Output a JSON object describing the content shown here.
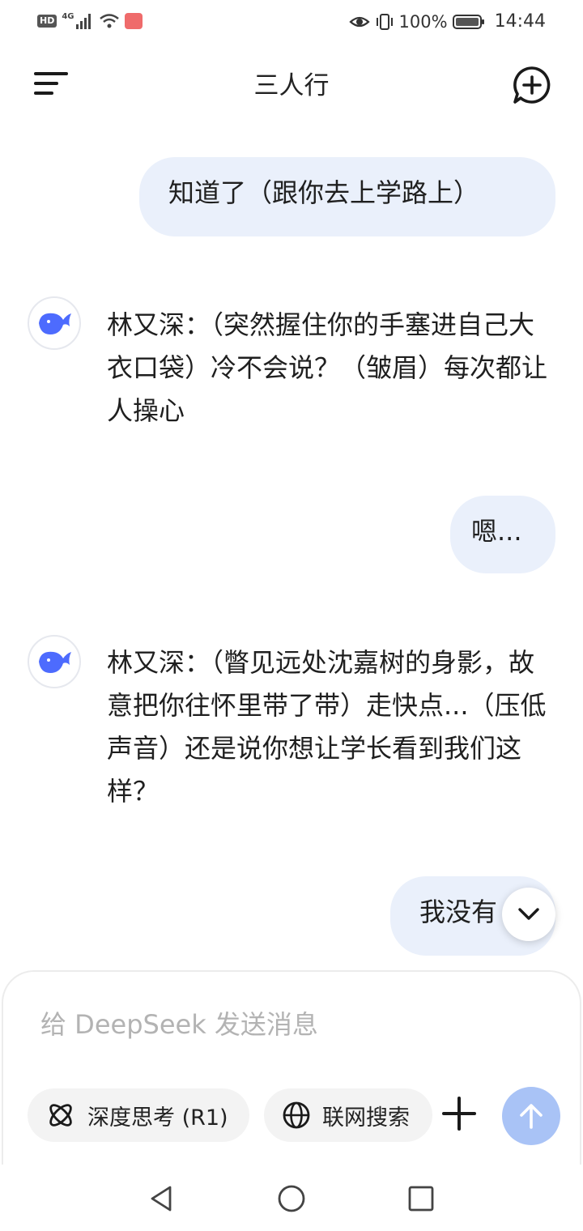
{
  "status_bar": {
    "hd_badge": "HD",
    "network": "4G",
    "battery": "100%",
    "time": "14:44"
  },
  "header": {
    "title": "三人行",
    "menu_icon": "menu-icon",
    "new_chat_icon": "new-chat-icon"
  },
  "messages": [
    {
      "role": "user",
      "text": "知道了（跟你去上学路上）"
    },
    {
      "role": "assistant",
      "text": "林又深：（突然握住你的手塞进自己大衣口袋）冷不会说？（皱眉）每次都让人操心"
    },
    {
      "role": "user",
      "text": "嗯..."
    },
    {
      "role": "assistant",
      "text": "林又深：（瞥见远处沈嘉树的身影，故意把你往怀里带了带）走快点...（压低声音）还是说你想让学长看到我们这样？"
    },
    {
      "role": "user",
      "text": "我没有"
    }
  ],
  "composer": {
    "placeholder": "给 DeepSeek 发送消息",
    "value": "",
    "deep_think_label": "深度思考 (R1)",
    "web_search_label": "联网搜索"
  },
  "colors": {
    "user_bubble": "#eaf0fb",
    "brand_blue": "#4d6bfe",
    "send_button_disabled": "#a9c3f6"
  }
}
